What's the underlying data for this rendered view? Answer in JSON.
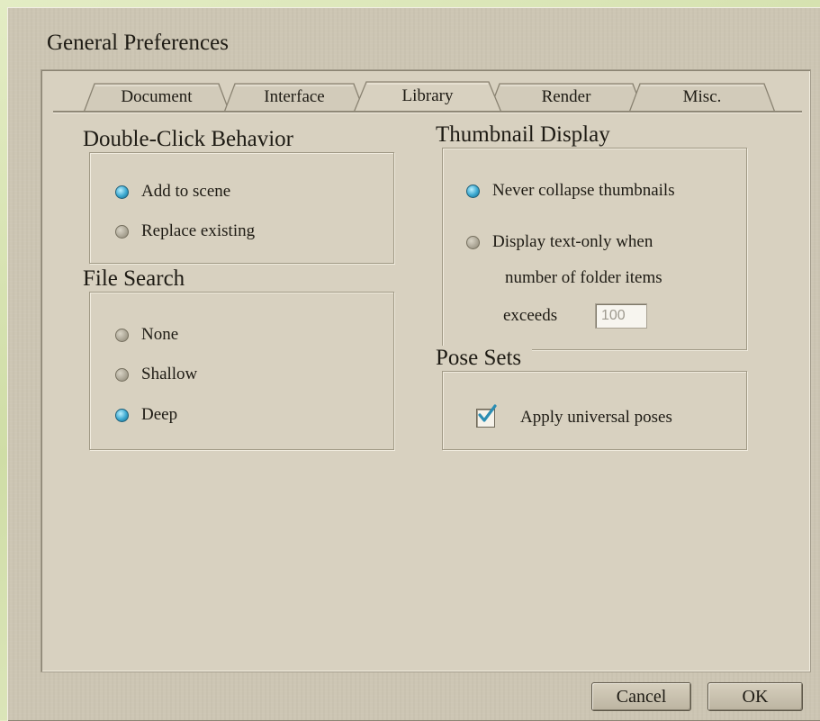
{
  "dialog": {
    "title": "General Preferences"
  },
  "tabs": [
    {
      "label": "Document",
      "active": false
    },
    {
      "label": "Interface",
      "active": false
    },
    {
      "label": "Library",
      "active": true
    },
    {
      "label": "Render",
      "active": false
    },
    {
      "label": "Misc.",
      "active": false
    }
  ],
  "double_click": {
    "title": "Double-Click Behavior",
    "options": [
      {
        "label": "Add to scene",
        "selected": true
      },
      {
        "label": "Replace existing",
        "selected": false
      }
    ]
  },
  "file_search": {
    "title": "File Search",
    "options": [
      {
        "label": "None",
        "selected": false
      },
      {
        "label": "Shallow",
        "selected": false
      },
      {
        "label": "Deep",
        "selected": true
      }
    ]
  },
  "thumbnail_display": {
    "title": "Thumbnail Display",
    "option_never": {
      "label": "Never collapse thumbnails",
      "selected": true
    },
    "option_text_only": {
      "line1": "Display text-only when",
      "line2": "number of folder items",
      "line3": "exceeds",
      "selected": false
    },
    "limit_value": "100"
  },
  "pose_sets": {
    "title": "Pose Sets",
    "apply_universal": {
      "label": "Apply universal poses",
      "checked": true
    }
  },
  "buttons": {
    "cancel": "Cancel",
    "ok": "OK"
  },
  "colors": {
    "dialog_bg": "#cdc6b4",
    "panel_bg": "#d8d1c0",
    "radio_selected": "#3aa7cf",
    "check_mark": "#2b8db3"
  }
}
